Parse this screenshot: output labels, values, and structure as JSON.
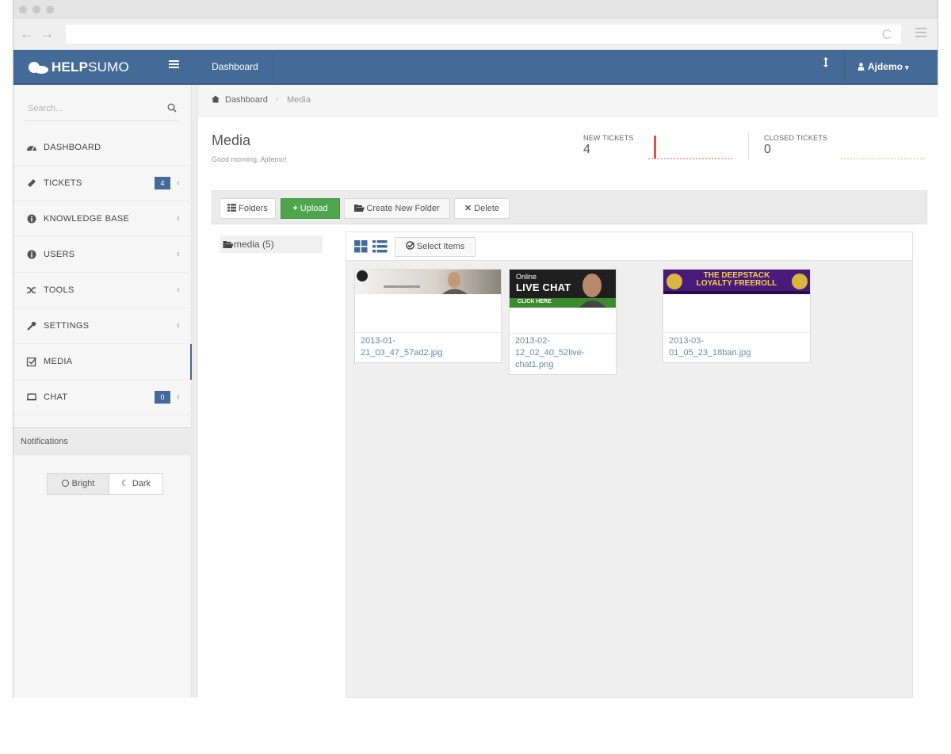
{
  "browser": {
    "back_glyph": "←",
    "forward_glyph": "→",
    "reload_glyph": "C"
  },
  "header": {
    "brand_bold": "HELP",
    "brand_light": "SUMO",
    "nav_label": "Dashboard",
    "user_label": "Ajdemo",
    "accent": "#446b97"
  },
  "sidebar": {
    "search_placeholder": "Search...",
    "items": [
      {
        "label": "DASHBOARD",
        "icon": "dashboard-icon"
      },
      {
        "label": "TICKETS",
        "icon": "ticket-icon",
        "badge": "4"
      },
      {
        "label": "KNOWLEDGE BASE",
        "icon": "info-icon"
      },
      {
        "label": "USERS",
        "icon": "users-icon"
      },
      {
        "label": "TOOLS",
        "icon": "shuffle-icon"
      },
      {
        "label": "SETTINGS",
        "icon": "wrench-icon"
      },
      {
        "label": "MEDIA",
        "icon": "media-icon"
      },
      {
        "label": "CHAT",
        "icon": "chat-icon",
        "badge": "0"
      }
    ],
    "notifications_label": "Notifications",
    "theme": {
      "bright": "Bright",
      "dark": "Dark"
    }
  },
  "breadcrumb": [
    "Dashboard",
    "Media"
  ],
  "page": {
    "title": "Media",
    "subtitle": "Good morning, Ajdemo!"
  },
  "stats": {
    "new_label": "NEW TICKETS",
    "new_value": "4",
    "closed_label": "CLOSED TICKETS",
    "closed_value": "0"
  },
  "toolbar": {
    "folders": "Folders",
    "upload": "Upload",
    "create_folder": "Create New Folder",
    "delete": "Delete"
  },
  "folder": {
    "label": "media (5)"
  },
  "gallery": {
    "select_label": "Select Items",
    "items": [
      {
        "name_line1": "2013-01-",
        "name_line2": "21_03_47_57ad2.jpg"
      },
      {
        "name_line1": "2013-02-",
        "name_line2": "12_02_40_52live-",
        "name_line3": "chat1.png",
        "banner_line1": "Online",
        "banner_line2": "LIVE CHAT",
        "banner_cta": "CLICK HERE"
      },
      {
        "name_line1": "2013-03-",
        "name_line2": "01_05_23_18ban.jpg",
        "banner_line1": "THE DEEPSTACK",
        "banner_line2": "LOYALTY FREEROLL"
      }
    ]
  }
}
